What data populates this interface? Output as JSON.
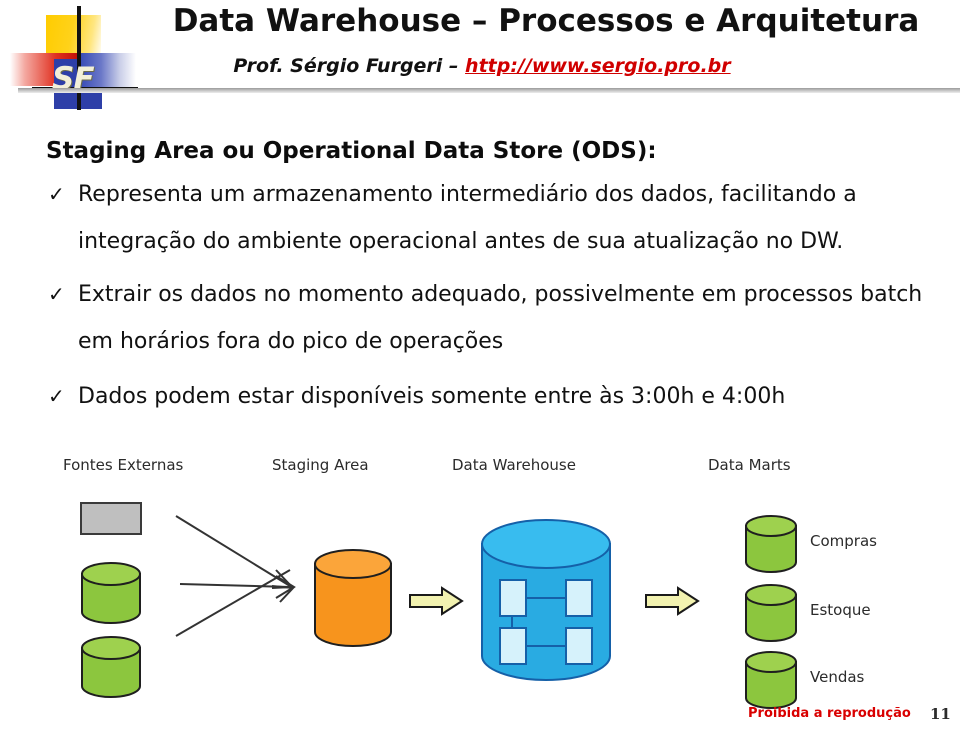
{
  "header": {
    "logo_text": "SF",
    "title": "Data Warehouse – Processos e Arquitetura",
    "author": "Prof. Sérgio Furgeri – ",
    "website": "http://www.sergio.pro.br"
  },
  "content": {
    "heading": "Staging Area  ou Operational Data Store (ODS):",
    "bullet_marker": "✓",
    "bullets": [
      "Representa um armazenamento intermediário dos dados, facilitando a integração do ambiente operacional antes de sua atualização no DW.",
      "Extrair os dados no momento adequado, possivelmente em processos batch em horários fora do pico de operações",
      "Dados podem estar disponíveis somente entre às 3:00h e 4:00h"
    ]
  },
  "diagram": {
    "columns": [
      {
        "label": "Fontes Externas"
      },
      {
        "label": "Staging Area"
      },
      {
        "label": "Data Warehouse"
      },
      {
        "label": "Data Marts"
      }
    ],
    "data_marts": [
      "Compras",
      "Estoque",
      "Vendas"
    ],
    "colors": {
      "source_rect": "#BFBFBF",
      "source_cylinder": "#8CC63E",
      "staging_cylinder": "#F7941D",
      "warehouse_cylinder": "#29ABE2",
      "warehouse_table": "#D6F2FB",
      "mart_cylinder": "#8CC63E",
      "block_arrow": "#F2F2B0",
      "thin_arrow": "#333333"
    }
  },
  "footer": {
    "notice": "Proibida a reprodução",
    "page_number": "11"
  }
}
